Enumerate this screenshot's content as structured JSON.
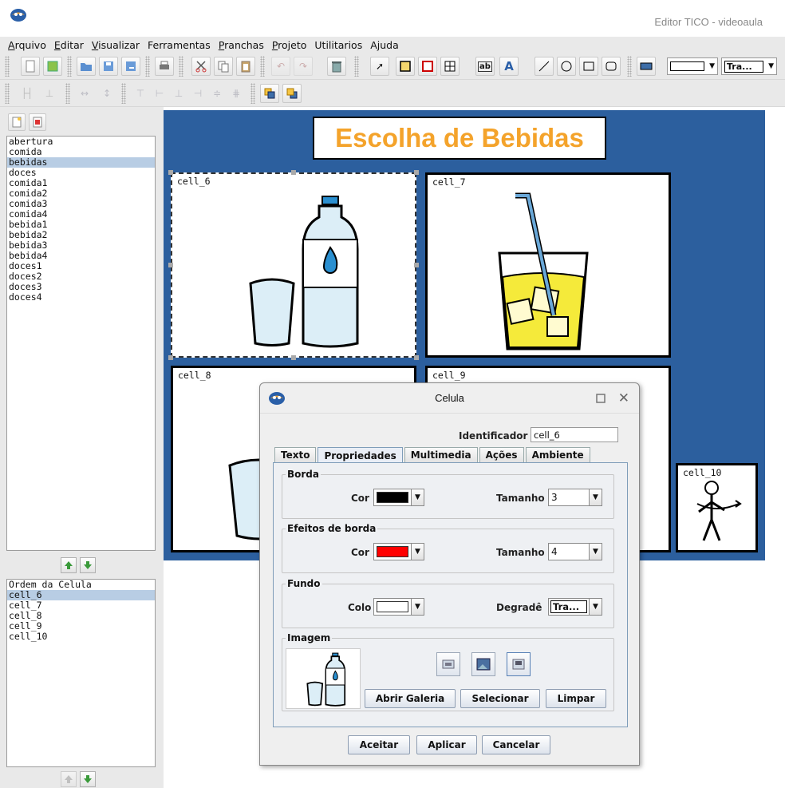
{
  "window": {
    "title": "Editor TICO - videoaula"
  },
  "menu": [
    "Arquivo",
    "Editar",
    "Visualizar",
    "Ferramentas",
    "Pranchas",
    "Projeto",
    "Utilitarios",
    "Ajuda"
  ],
  "toolbar": {
    "font_combo_value": "Tra..."
  },
  "boards": {
    "items": [
      "abertura",
      "comida",
      "bebidas",
      "doces",
      "comida1",
      "comida2",
      "comida3",
      "comida4",
      "bebida1",
      "bebida2",
      "bebida3",
      "bebida4",
      "doces1",
      "doces2",
      "doces3",
      "doces4"
    ],
    "selected": "bebidas"
  },
  "cell_order": {
    "title": "Ordem da Celula",
    "items": [
      "cell_6",
      "cell_7",
      "cell_8",
      "cell_9",
      "cell_10"
    ],
    "selected": "cell_6"
  },
  "board": {
    "heading": "Escolha de Bebidas",
    "heading_color": "#f4a32b",
    "background_color": "#2c5f9e",
    "cells": [
      {
        "id": "cell_6",
        "image": "water-bottle-and-glass"
      },
      {
        "id": "cell_7",
        "image": "juice-glass-with-straw"
      },
      {
        "id": "cell_8",
        "image": "glass"
      },
      {
        "id": "cell_9",
        "image": ""
      },
      {
        "id": "cell_10",
        "image": "stick-figure-turning"
      }
    ]
  },
  "dialog": {
    "title": "Celula",
    "identifier_label": "Identificador",
    "identifier_value": "cell_6",
    "tabs": [
      "Texto",
      "Propriedades",
      "Multimedia",
      "Ações",
      "Ambiente"
    ],
    "active_tab": "Propriedades",
    "border": {
      "title": "Borda",
      "color_label": "Cor",
      "color": "#000000",
      "size_label": "Tamanho",
      "size": "3"
    },
    "border_effects": {
      "title": "Efeitos de borda",
      "color_label": "Cor",
      "color": "#ff0000",
      "size_label": "Tamanho",
      "size": "4"
    },
    "background": {
      "title": "Fundo",
      "color_label": "Colo",
      "color": "#ffffff",
      "gradient_label": "Degradê",
      "gradient": "Tra..."
    },
    "image": {
      "title": "Imagem",
      "open_gallery": "Abrir Galeria",
      "select": "Selecionar",
      "clear": "Limpar"
    },
    "buttons": {
      "accept": "Aceitar",
      "apply": "Aplicar",
      "cancel": "Cancelar"
    }
  }
}
